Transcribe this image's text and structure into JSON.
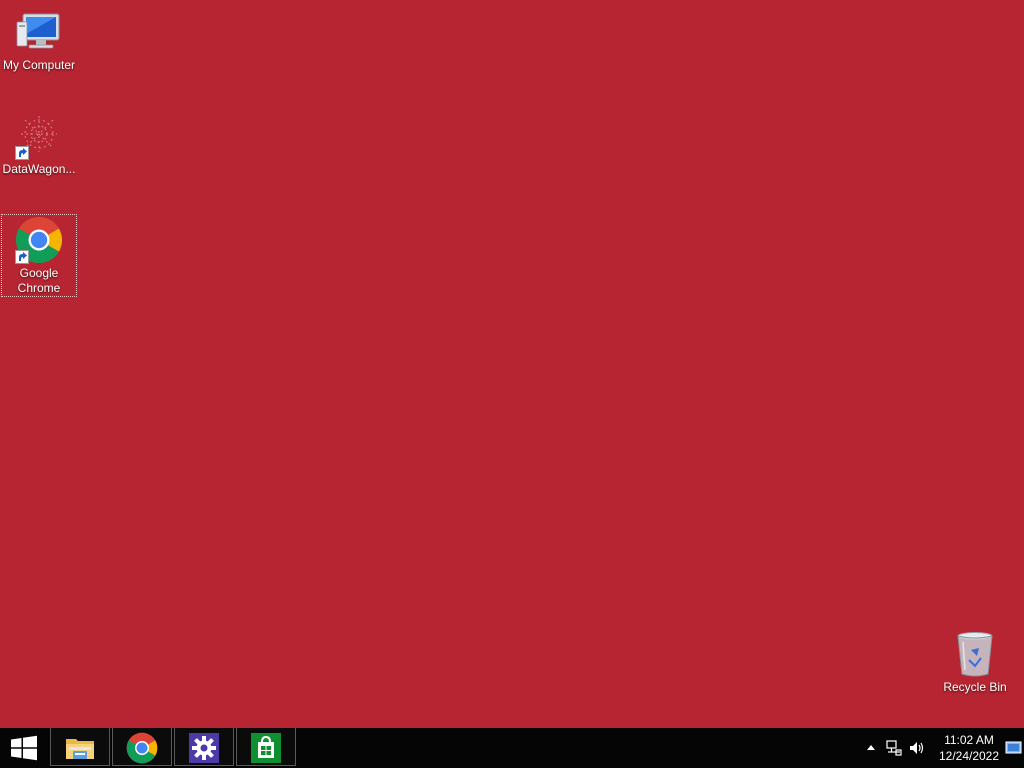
{
  "desktop": {
    "background_color": "#b72532",
    "icons": [
      {
        "label": "My Computer",
        "icon": "computer-icon"
      },
      {
        "label": "DataWagon...",
        "icon": "datawagon-icon"
      },
      {
        "label": "Google Chrome",
        "icon": "chrome-icon",
        "selected": true
      },
      {
        "label": "Recycle Bin",
        "icon": "recycle-bin-icon"
      }
    ]
  },
  "taskbar": {
    "start_icon": "windows-start-icon",
    "pinned": [
      {
        "name": "File Explorer",
        "icon": "file-explorer-icon"
      },
      {
        "name": "Google Chrome",
        "icon": "chrome-icon"
      },
      {
        "name": "Settings",
        "icon": "settings-gear-icon"
      },
      {
        "name": "Store",
        "icon": "store-icon"
      }
    ],
    "tray": {
      "icons": [
        "show-hidden-icons-chevron",
        "network-icon",
        "volume-icon"
      ],
      "time": "11:02 AM",
      "date": "12/24/2022",
      "desktop_icon": "show-desktop-icon"
    }
  }
}
